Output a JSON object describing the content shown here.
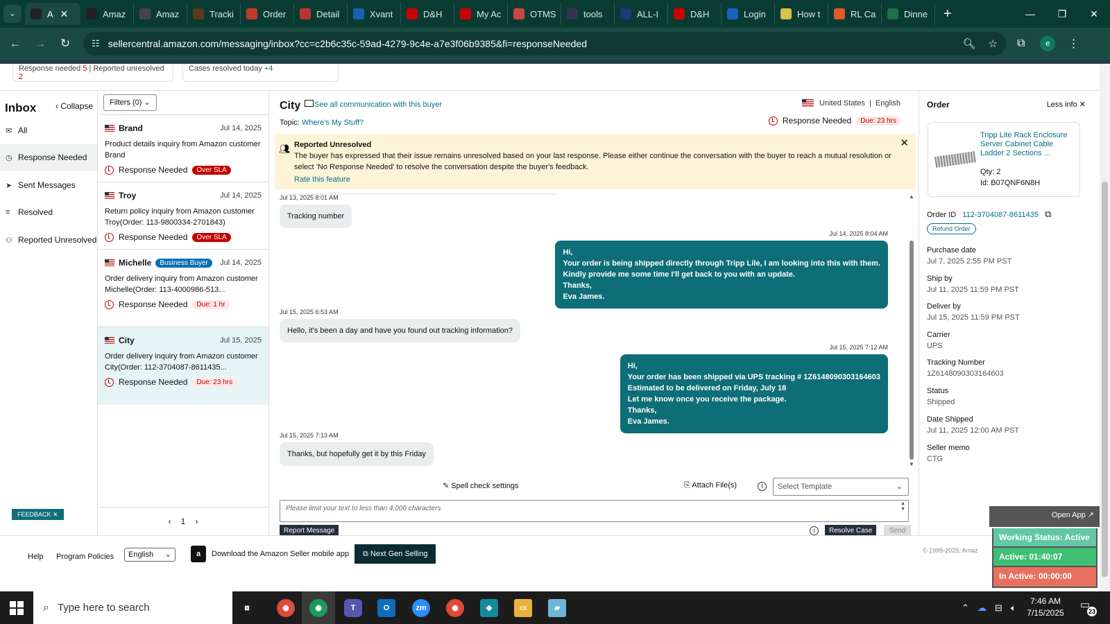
{
  "browser": {
    "tabs": [
      {
        "label": "A",
        "icon": "amazon-icon",
        "color": "#222222",
        "active": true
      },
      {
        "label": "Amaz",
        "icon": "amazon-icon",
        "color": "#222222"
      },
      {
        "label": "Amaz",
        "icon": "amazon-icon",
        "color": "#444444"
      },
      {
        "label": "Tracki",
        "icon": "ups-icon",
        "color": "#5a3a1a"
      },
      {
        "label": "Order",
        "icon": "stack-icon",
        "color": "#c0392b"
      },
      {
        "label": "Detail",
        "icon": "flag-icon",
        "color": "#b33"
      },
      {
        "label": "Xvant",
        "icon": "x-icon",
        "color": "#1a5fb4"
      },
      {
        "label": "D&H",
        "icon": "dh-icon",
        "color": "#c00"
      },
      {
        "label": "My Ac",
        "icon": "link-icon",
        "color": "#c00"
      },
      {
        "label": "OTMS",
        "icon": "otms-icon",
        "color": "#c44"
      },
      {
        "label": "tools",
        "icon": "tools-icon",
        "color": "#335"
      },
      {
        "label": "ALL-I",
        "icon": "ti-icon",
        "color": "#1a3a7a"
      },
      {
        "label": "D&H",
        "icon": "dh-icon",
        "color": "#c00"
      },
      {
        "label": "Login",
        "icon": "ec-icon",
        "color": "#1565c0"
      },
      {
        "label": "How t",
        "icon": "circle-icon",
        "color": "#d6c04a"
      },
      {
        "label": "RL Ca",
        "icon": "rl-icon",
        "color": "#e05a2a"
      },
      {
        "label": "Dinne",
        "icon": "excel-icon",
        "color": "#1e7145"
      }
    ],
    "url_host": "sellercentral.amazon.com",
    "url_path": "/messaging/inbox?cc=c2b6c35c-59ad-4279-9c4e-a7e3f06b9385&fi=responseNeeded",
    "profile_initial": "e"
  },
  "stats": {
    "response_needed_label": "Response needed",
    "response_needed_count": "5",
    "reported_unresolved_label": "Reported unresolved",
    "reported_unresolved_count": "2",
    "cases_resolved_label": "Cases resolved today",
    "cases_resolved_count": "+4"
  },
  "leftnav": {
    "title": "Inbox",
    "collapse": "Collapse",
    "items": [
      {
        "label": "All",
        "icon": "mail-icon"
      },
      {
        "label": "Response Needed",
        "icon": "clock-icon"
      },
      {
        "label": "Sent Messages",
        "icon": "send-icon"
      },
      {
        "label": "Resolved",
        "icon": "resolved-icon"
      },
      {
        "label": "Reported Unresolved",
        "icon": "person-alert-icon"
      }
    ]
  },
  "convlist": {
    "filters": "Filters (0)",
    "items": [
      {
        "name": "Brand",
        "date": "Jul 14, 2025",
        "subject": "Product details inquiry from Amazon customer Brand",
        "status": "Response Needed",
        "badge": "Over SLA",
        "badge_type": "sla"
      },
      {
        "name": "Troy",
        "date": "Jul 14, 2025",
        "subject": "Return policy inquiry from Amazon customer Troy(Order: 113-9800334-2701843)",
        "status": "Response Needed",
        "badge": "Over SLA",
        "badge_type": "sla"
      },
      {
        "name": "Michelle",
        "tag": "Business Buyer",
        "date": "Jul 14, 2025",
        "subject": "Order delivery inquiry from Amazon customer Michelle(Order: 113-4000986-513...",
        "status": "Response Needed",
        "badge": "Due: 1 hr",
        "badge_type": "due"
      },
      {
        "name": "City",
        "date": "Jul 15, 2025",
        "subject": "Order delivery inquiry from Amazon customer City(Order: 112-3704087-8611435...",
        "status": "Response Needed",
        "badge": "Due: 23 hrs",
        "badge_type": "due",
        "selected": true
      }
    ],
    "page": "1"
  },
  "conversation": {
    "buyer": "City",
    "see_all": "See all communication with this buyer",
    "country": "United States",
    "language": "English",
    "topic_label": "Topic:",
    "topic": "Where's My Stuff?",
    "status": "Response Needed",
    "due": "Due: 23 hrs",
    "banner_title": "Reported Unresolved",
    "banner_text": "The buyer has expressed that their issue remains unresolved based on your last response. Please either continue the conversation with the buyer to reach a mutual resolution or select 'No Response Needed' to resolve the conversation despite the buyer's feedback.",
    "banner_link": "Rate this feature",
    "messages": [
      {
        "dir": "in",
        "time": "Jul 13, 2025 8:01 AM",
        "lines": [
          "Tracking number"
        ]
      },
      {
        "dir": "out",
        "time": "Jul 14, 2025 8:04 AM",
        "lines": [
          "Hi,",
          "Your order is being shipped directly through Tripp Lile, I am looking into this with them.",
          "Kindly provide me some time I'll get back to you with an update.",
          "Thanks,",
          "Eva James."
        ]
      },
      {
        "dir": "in",
        "time": "Jul 15, 2025 6:53 AM",
        "lines": [
          "Hello, it's been a day and have you found out tracking information?"
        ]
      },
      {
        "dir": "out",
        "time": "Jul 15, 2025 7:12 AM",
        "lines": [
          "Hi,",
          "Your order has been shipped via UPS tracking # 1Z6148090303164603",
          "Estimated to be delivered on Friday, July 18",
          "Let me know once you receive the package.",
          "Thanks,",
          "Eva James."
        ]
      },
      {
        "dir": "in",
        "time": "Jul 15, 2025 7:13 AM",
        "lines": [
          "Thanks, but hopefully get it by this Friday"
        ]
      }
    ],
    "spell_check": "Spell check settings",
    "attach": "Attach File(s)",
    "template_placeholder": "Select Template",
    "textarea_placeholder": "Please limit your text to less than 4,000 characters",
    "report": "Report Message",
    "resolve": "Resolve Case",
    "send": "Send"
  },
  "order": {
    "title": "Order",
    "less_info": "Less info",
    "product_name": "Tripp Lite Rack Enclosure Server Cabinet Cable Ladder 2 Sections ...",
    "qty_label": "Qty:",
    "qty": "2",
    "id_label": "Id:",
    "asin": "B07QNF6N8H",
    "order_id_label": "Order ID",
    "order_id": "112-3704087-8611435",
    "refund": "Refund Order",
    "fields": [
      {
        "label": "Purchase date",
        "value": "Jul 7, 2025 2:55 PM PST"
      },
      {
        "label": "Ship by",
        "value": "Jul 11, 2025 11:59 PM PST"
      },
      {
        "label": "Deliver by",
        "value": "Jul 15, 2025 11:59 PM PST"
      },
      {
        "label": "Carrier",
        "value": "UPS"
      },
      {
        "label": "Tracking Number",
        "value": "1Z6148090303164603"
      },
      {
        "label": "Status",
        "value": "Shipped"
      },
      {
        "label": "Date Shipped",
        "value": "Jul 11, 2025 12:00 AM PST"
      },
      {
        "label": "Seller memo",
        "value": "CTG"
      }
    ]
  },
  "footer": {
    "help": "Help",
    "policies": "Program Policies",
    "language": "English",
    "app_text": "Download the Amazon Seller mobile app",
    "next_gen": "Next Gen Selling",
    "copyright": "© 1999-2025, Amaz",
    "feedback": "FEEDBACK"
  },
  "working_status": {
    "open_app": "Open App",
    "status": "Working Status: Active",
    "active": "Active: 01:40:07",
    "inactive": "In Active: 00:00:00"
  },
  "taskbar": {
    "search_placeholder": "Type here to search",
    "time": "7:46 AM",
    "date": "7/15/2025",
    "notifications": "23"
  }
}
